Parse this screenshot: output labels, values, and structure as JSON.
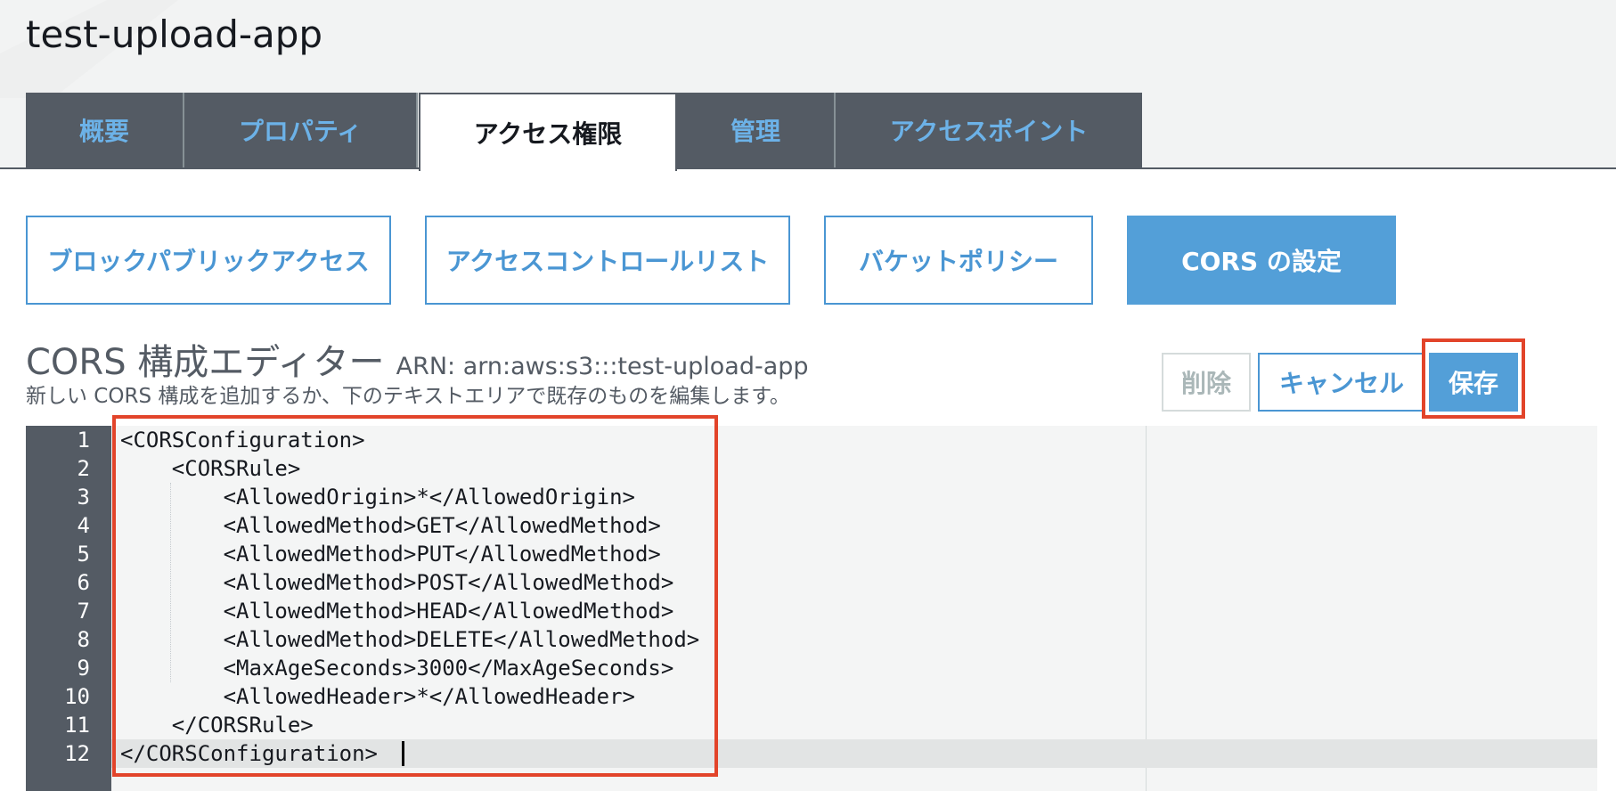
{
  "bucket": {
    "name": "test-upload-app"
  },
  "tabs": [
    {
      "label": "概要"
    },
    {
      "label": "プロパティ"
    },
    {
      "label": "アクセス権限"
    },
    {
      "label": "管理"
    },
    {
      "label": "アクセスポイント"
    }
  ],
  "active_tab": "アクセス権限",
  "subtabs": [
    {
      "label": "ブロックパブリックアクセス"
    },
    {
      "label": "アクセスコントロールリスト"
    },
    {
      "label": "バケットポリシー"
    },
    {
      "label": "CORS の設定"
    }
  ],
  "active_subtab": "CORS の設定",
  "editor_header": {
    "title": "CORS 構成エディター",
    "arn": "ARN: arn:aws:s3:::test-upload-app",
    "description": "新しい CORS 構成を追加するか、下のテキストエリアで既存のものを編集します。"
  },
  "actions": {
    "delete_label": "削除",
    "cancel_label": "キャンセル",
    "save_label": "保存",
    "delete_disabled": true
  },
  "editor": {
    "line_numbers": [
      "1",
      "2",
      "3",
      "4",
      "5",
      "6",
      "7",
      "8",
      "9",
      "10",
      "11",
      "12"
    ],
    "lines": [
      "<CORSConfiguration>",
      "    <CORSRule>",
      "        <AllowedOrigin>*</AllowedOrigin>",
      "        <AllowedMethod>GET</AllowedMethod>",
      "        <AllowedMethod>PUT</AllowedMethod>",
      "        <AllowedMethod>POST</AllowedMethod>",
      "        <AllowedMethod>HEAD</AllowedMethod>",
      "        <AllowedMethod>DELETE</AllowedMethod>",
      "        <MaxAgeSeconds>3000</MaxAgeSeconds>",
      "        <AllowedHeader>*</AllowedHeader>",
      "    </CORSRule>",
      "</CORSConfiguration>"
    ],
    "active_line": "12"
  },
  "colors": {
    "nav_dark": "#545b64",
    "link_blue": "#4a96d3",
    "primary_blue": "#539fd8",
    "annotation_red": "#e2442a"
  }
}
